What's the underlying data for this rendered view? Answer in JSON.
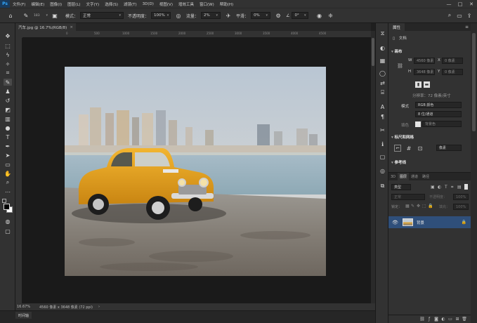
{
  "app": {
    "logo": "Ps"
  },
  "menu": [
    "文件(F)",
    "编辑(E)",
    "图像(I)",
    "图层(L)",
    "文字(Y)",
    "选择(S)",
    "滤镜(T)",
    "3D(D)",
    "视图(V)",
    "增效工具",
    "窗口(W)",
    "帮助(H)"
  ],
  "window_controls": [
    "—",
    "□",
    "✕"
  ],
  "options": {
    "brush_size": "183",
    "mode_label": "模式：",
    "mode_value": "正常",
    "opacity_label": "不透明度：",
    "opacity_value": "100%",
    "flow_label": "流量：",
    "flow_value": "2%",
    "smooth_label": "平滑：",
    "smooth_value": "0%",
    "angle_value": "0°"
  },
  "document": {
    "tab_title": "汽车.jpg @ 16.7%(RGB/8)",
    "tab_close": "×",
    "status_zoom": "16.67%",
    "status_info": "4560 像素 x 3648 像素 (72 ppi)",
    "status_arrow": "›"
  },
  "timeline": {
    "label": "时间轴"
  },
  "ruler_ticks": [
    "0",
    "500",
    "1000",
    "1500",
    "2000",
    "2500",
    "3000",
    "3500",
    "4000",
    "4500"
  ],
  "properties": {
    "tab": "属性",
    "doc_label": "文档",
    "canvas_section": "画布",
    "w_label": "W",
    "w_value": "4560 像素",
    "h_label": "H",
    "h_value": "3648 像素",
    "x_label": "X",
    "x_value": "0 像素",
    "y_label": "Y",
    "y_value": "0 像素",
    "resolution": "分辨率：72 像素/英寸",
    "mode_label": "模式",
    "mode_value": "RGB 颜色",
    "bits_value": "8 位/通道",
    "fill_label": "填色",
    "fill_value": "背景色",
    "rulers_section": "标尺和网格",
    "units_value": "像素",
    "guides_section": "参考线"
  },
  "layers": {
    "tabs": [
      "3D",
      "图层",
      "通道",
      "路径"
    ],
    "active_tab": "图层",
    "filter_value": "类型",
    "blend_value": "正常",
    "opacity_label": "不透明度：",
    "opacity_value": "100%",
    "lock_label": "锁定：",
    "fill_label": "填充：",
    "fill_value": "100%",
    "layer_name": "背景"
  }
}
